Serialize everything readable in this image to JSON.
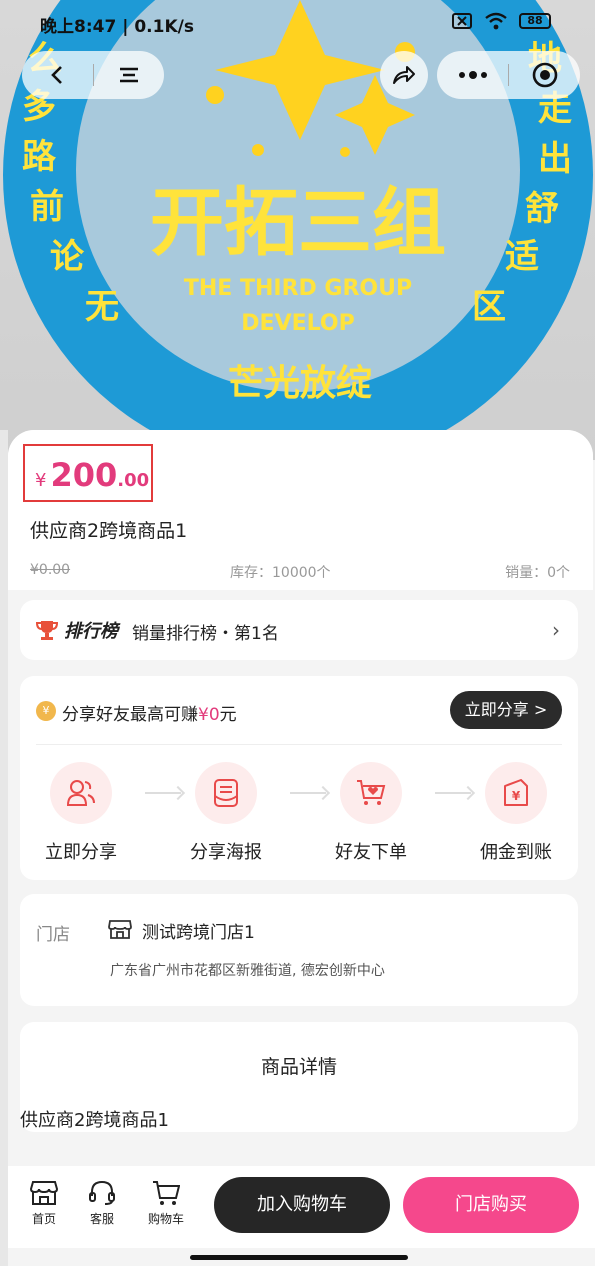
{
  "status": {
    "time": "晚上8:47 | 0.1K/s",
    "battery": "88"
  },
  "banner": {
    "main_text": "开拓三组",
    "english_line1": "THE THIRD GROUP",
    "english_line2": "DEVELOP",
    "bottom_text": "芒光放绽",
    "left_chars": [
      "么",
      "多",
      "路",
      "前",
      "论",
      "无"
    ],
    "right_chars": [
      "地",
      "走",
      "出",
      "舒",
      "适",
      "区"
    ],
    "colors": {
      "ring": "#1e9ad6",
      "inner": "#a8c9dc",
      "text": "#ffe33b"
    }
  },
  "product": {
    "price_currency": "¥",
    "price_int": "200",
    "price_dec": ".00",
    "title": "供应商2跨境商品1",
    "original_price": "¥0.00",
    "stock": "库存：10000个",
    "sales": "销量：0个"
  },
  "ranking": {
    "brand": "排行榜",
    "text": "销量排行榜・第1名"
  },
  "share": {
    "coin": "¥",
    "title_prefix": "分享好友最高可赚",
    "amount": "¥0",
    "title_suffix": "元",
    "button": "立即分享 >",
    "steps": [
      {
        "label": "立即分享",
        "icon": "users-icon"
      },
      {
        "label": "分享海报",
        "icon": "poster-icon"
      },
      {
        "label": "好友下单",
        "icon": "cart-heart-icon"
      },
      {
        "label": "佣金到账",
        "icon": "money-bag-icon"
      }
    ]
  },
  "store": {
    "label": "门店",
    "name": "测试跨境门店1",
    "address": "广东省广州市花都区新雅街道, 德宏创新中心"
  },
  "detail": {
    "title": "商品详情",
    "body": "供应商2跨境商品1"
  },
  "bottom": {
    "tabs": [
      "首页",
      "客服",
      "购物车"
    ],
    "add_to_cart": "加入购物车",
    "buy": "门店购买"
  },
  "colors": {
    "accent_pink": "#f5488c",
    "price": "#e23b7c",
    "dark_button": "#262626"
  }
}
